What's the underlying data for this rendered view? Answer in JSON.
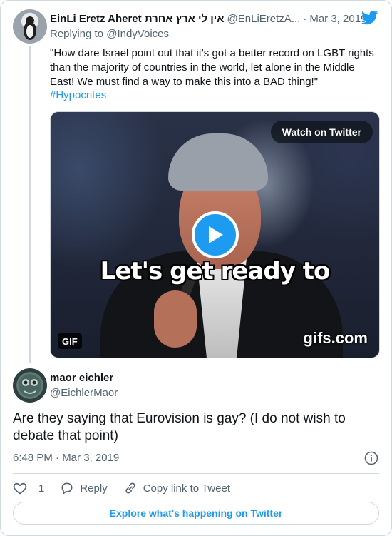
{
  "parent_tweet": {
    "display_name": "EinLi Eretz Aheret אין לי ארץ אחרת",
    "handle": "@EnLiEretzA...",
    "date": "Mar 3, 2019",
    "replying_to_prefix": "Replying to",
    "replying_to_handle": "@IndyVoices",
    "text": "\"How dare Israel point out that it's got a better record on LGBT rights than the majority of countries in the world, let alone in the Middle East! We must find a way to make this into a BAD thing!\"",
    "hashtag": "#Hypocrites",
    "media": {
      "watch_label": "Watch on Twitter",
      "caption": "Let's get ready to",
      "gif_badge": "GIF",
      "watermark": "gifs.com"
    }
  },
  "main_tweet": {
    "display_name": "maor eichler",
    "handle": "@EichlerMaor",
    "text": "Are they saying that Eurovision is gay? (I do not wish to debate that point)",
    "timestamp": "6:48 PM · Mar 3, 2019"
  },
  "actions": {
    "like_count": "1",
    "reply_label": "Reply",
    "copy_link_label": "Copy link to Tweet"
  },
  "footer": {
    "explore_label": "Explore what's happening on Twitter"
  },
  "colors": {
    "accent": "#1d9bf0",
    "text": "#0f1419",
    "secondary": "#536471",
    "border": "#cfd9de"
  },
  "icons": [
    "twitter-bird-icon",
    "play-icon",
    "info-icon",
    "heart-icon",
    "reply-icon",
    "link-icon"
  ]
}
